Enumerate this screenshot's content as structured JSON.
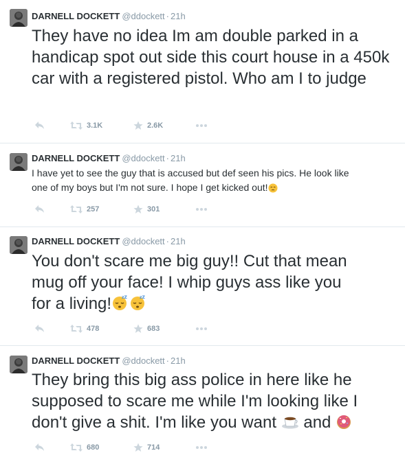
{
  "tweets": [
    {
      "name": "DARNELL DOCKETT",
      "handle": "@ddockett",
      "time": "21h",
      "text": "They have no idea Im am double parked in a handicap spot out side this court house in a 450k car with a registered pistol. Who am I to judge",
      "retweets": "3.1K",
      "favorites": "2.6K"
    },
    {
      "name": "DARNELL DOCKETT",
      "handle": "@ddockett",
      "time": "21h",
      "text_line1": "I have yet to see the guy that is accused but def seen his pics. He look like",
      "text_line2": "one of my boys but I'm not sure. I hope I get kicked out!",
      "retweets": "257",
      "favorites": "301"
    },
    {
      "name": "DARNELL DOCKETT",
      "handle": "@ddockett",
      "time": "21h",
      "text_line1": "You don't scare me big guy!!  Cut that mean",
      "text_line2": "mug off your face! I whip guys ass like you",
      "text_line3": "for a living!",
      "retweets": "478",
      "favorites": "683"
    },
    {
      "name": "DARNELL DOCKETT",
      "handle": "@ddockett",
      "time": "21h",
      "text_line1": "They bring this big ass police in here like he",
      "text_line2": "supposed to scare me while I'm looking like I",
      "text_line3a": "don't give a shit. I'm like you want",
      "text_line3b": "and",
      "retweets": "680",
      "favorites": "714"
    }
  ],
  "colors": {
    "text": "#292f33",
    "muted": "#8899a6",
    "action_icon": "#ccd6dd",
    "separator": "#e1e8ed"
  },
  "icons": [
    "reply-icon",
    "retweet-icon",
    "favorite-star-icon",
    "more-dots-icon",
    "sleepy-face-emoji",
    "coffee-emoji",
    "donut-emoji",
    "pensive-face-emoji"
  ]
}
